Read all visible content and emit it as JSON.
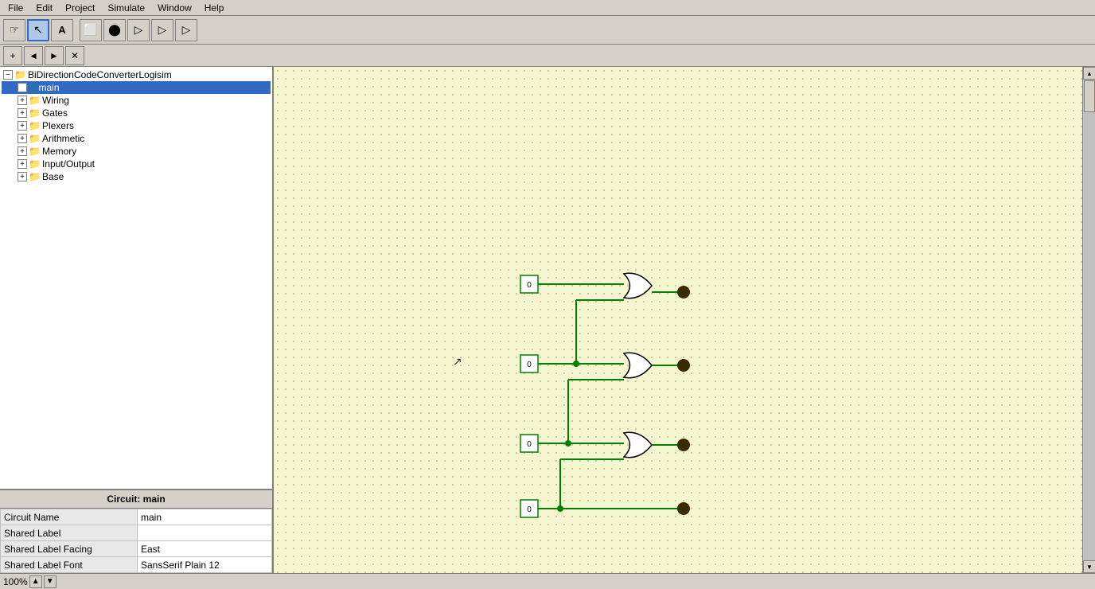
{
  "menubar": {
    "items": [
      "File",
      "Edit",
      "Project",
      "Simulate",
      "Window",
      "Help"
    ]
  },
  "toolbar": {
    "tools": [
      {
        "name": "hand-tool",
        "icon": "☞",
        "active": false
      },
      {
        "name": "pointer-tool",
        "icon": "↖",
        "active": true
      },
      {
        "name": "text-tool",
        "icon": "A",
        "active": false
      },
      {
        "name": "rectangle-tool",
        "icon": "□",
        "active": false
      },
      {
        "name": "ellipse-tool",
        "icon": "○",
        "active": false
      },
      {
        "name": "triangle-tool",
        "icon": "▷",
        "active": false
      },
      {
        "name": "triangle2-tool",
        "icon": "▷",
        "active": false
      },
      {
        "name": "triangle3-tool",
        "icon": "▷",
        "active": false
      }
    ]
  },
  "toolbar2": {
    "tools": [
      {
        "name": "add-btn",
        "icon": "+"
      },
      {
        "name": "back-btn",
        "icon": "←"
      },
      {
        "name": "fwd-btn",
        "icon": "→"
      },
      {
        "name": "close-btn",
        "icon": "✕"
      }
    ]
  },
  "explorer": {
    "root": "BiDirectionCodeConverterLogisim",
    "items": [
      {
        "label": "main",
        "type": "circuit",
        "level": 1,
        "selected": true
      },
      {
        "label": "Wiring",
        "type": "folder",
        "level": 1
      },
      {
        "label": "Gates",
        "type": "folder",
        "level": 1
      },
      {
        "label": "Plexers",
        "type": "folder",
        "level": 1
      },
      {
        "label": "Arithmetic",
        "type": "folder",
        "level": 1
      },
      {
        "label": "Memory",
        "type": "folder",
        "level": 1
      },
      {
        "label": "Input/Output",
        "type": "folder",
        "level": 1
      },
      {
        "label": "Base",
        "type": "folder",
        "level": 1
      }
    ]
  },
  "properties": {
    "title": "Circuit: main",
    "rows": [
      {
        "label": "Circuit Name",
        "value": "main"
      },
      {
        "label": "Shared Label",
        "value": ""
      },
      {
        "label": "Shared Label Facing",
        "value": "East"
      },
      {
        "label": "Shared Label Font",
        "value": "SansSerif Plain 12"
      }
    ]
  },
  "statusbar": {
    "zoom": "100%"
  },
  "colors": {
    "wire": "#008000",
    "dot": "#3a2a00",
    "gate_stroke": "#000000",
    "gate_fill": "#ffffff",
    "input_fill": "#ffffff"
  }
}
